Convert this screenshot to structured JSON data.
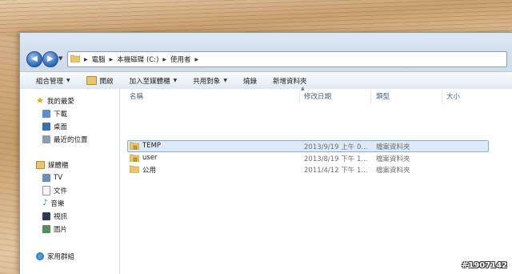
{
  "address": {
    "crumbs": [
      "電腦",
      "本機磁碟 (C:)",
      "使用者"
    ]
  },
  "toolbar": {
    "organize": "組合管理",
    "open": "開啟",
    "add_to_library": "加入至媒體櫃",
    "share_with": "共用對象",
    "burn": "燒錄",
    "new_folder": "新增資料夾"
  },
  "sidebar": {
    "favorites": {
      "label": "我的最愛",
      "items": [
        "下載",
        "桌面",
        "最近的位置"
      ]
    },
    "libraries": {
      "label": "媒體櫃",
      "items": [
        "TV",
        "文件",
        "音樂",
        "視訊",
        "圖片"
      ]
    },
    "homegroup": "家用群組"
  },
  "columns": {
    "name": "名稱",
    "date": "修改日期",
    "type": "類型",
    "size": "大小"
  },
  "files": [
    {
      "name": "TEMP",
      "date": "2013/9/19 上午 0...",
      "type": "檔案資料夾",
      "size": "",
      "selected": true
    },
    {
      "name": "user",
      "date": "2013/8/19 下午 1...",
      "type": "檔案資料夾",
      "size": "",
      "selected": false
    },
    {
      "name": "公用",
      "date": "2011/4/12 下午 1...",
      "type": "檔案資料夾",
      "size": "",
      "selected": false
    }
  ],
  "watermark": "#1907142",
  "colors": {
    "selection_bg": "#dbeafc",
    "selection_border": "#84acdd",
    "nav_button": "#3d77c4",
    "folder": "#e8c76a"
  }
}
